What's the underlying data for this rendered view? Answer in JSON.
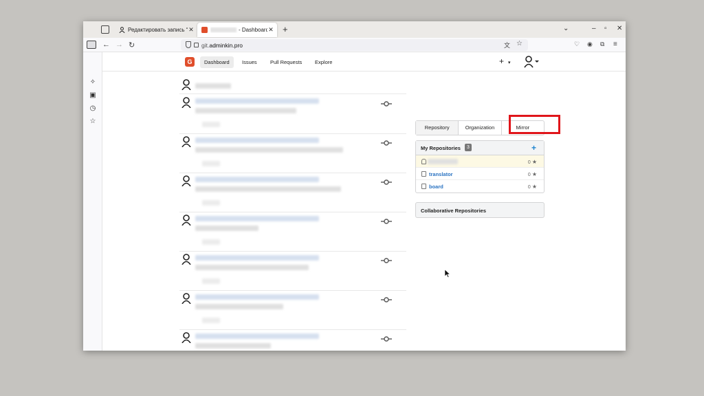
{
  "browser": {
    "tabs": [
      {
        "title": "Редактировать запись “Gi"
      },
      {
        "title": "- Dashboard - "
      }
    ],
    "url_domain": "git.",
    "url_host": "adminkin.pro"
  },
  "nav": {
    "logo": "G",
    "items": [
      "Dashboard",
      "Issues",
      "Pull Requests",
      "Explore"
    ],
    "plus": "+",
    "caret": "▾"
  },
  "right_panel": {
    "tabs": [
      "Repository",
      "Organization",
      "Mirror"
    ],
    "my_repos_title": "My Repositories",
    "my_repos_count": "3",
    "add": "+",
    "repos": [
      {
        "name": "",
        "stars": "0"
      },
      {
        "name": "translator",
        "stars": "0"
      },
      {
        "name": "board",
        "stars": "0"
      }
    ],
    "collab_title": "Collaborative Repositories"
  },
  "colors": {
    "highlight": "#e0151a",
    "accent": "#2185d0",
    "logo": "#e04e2b"
  }
}
